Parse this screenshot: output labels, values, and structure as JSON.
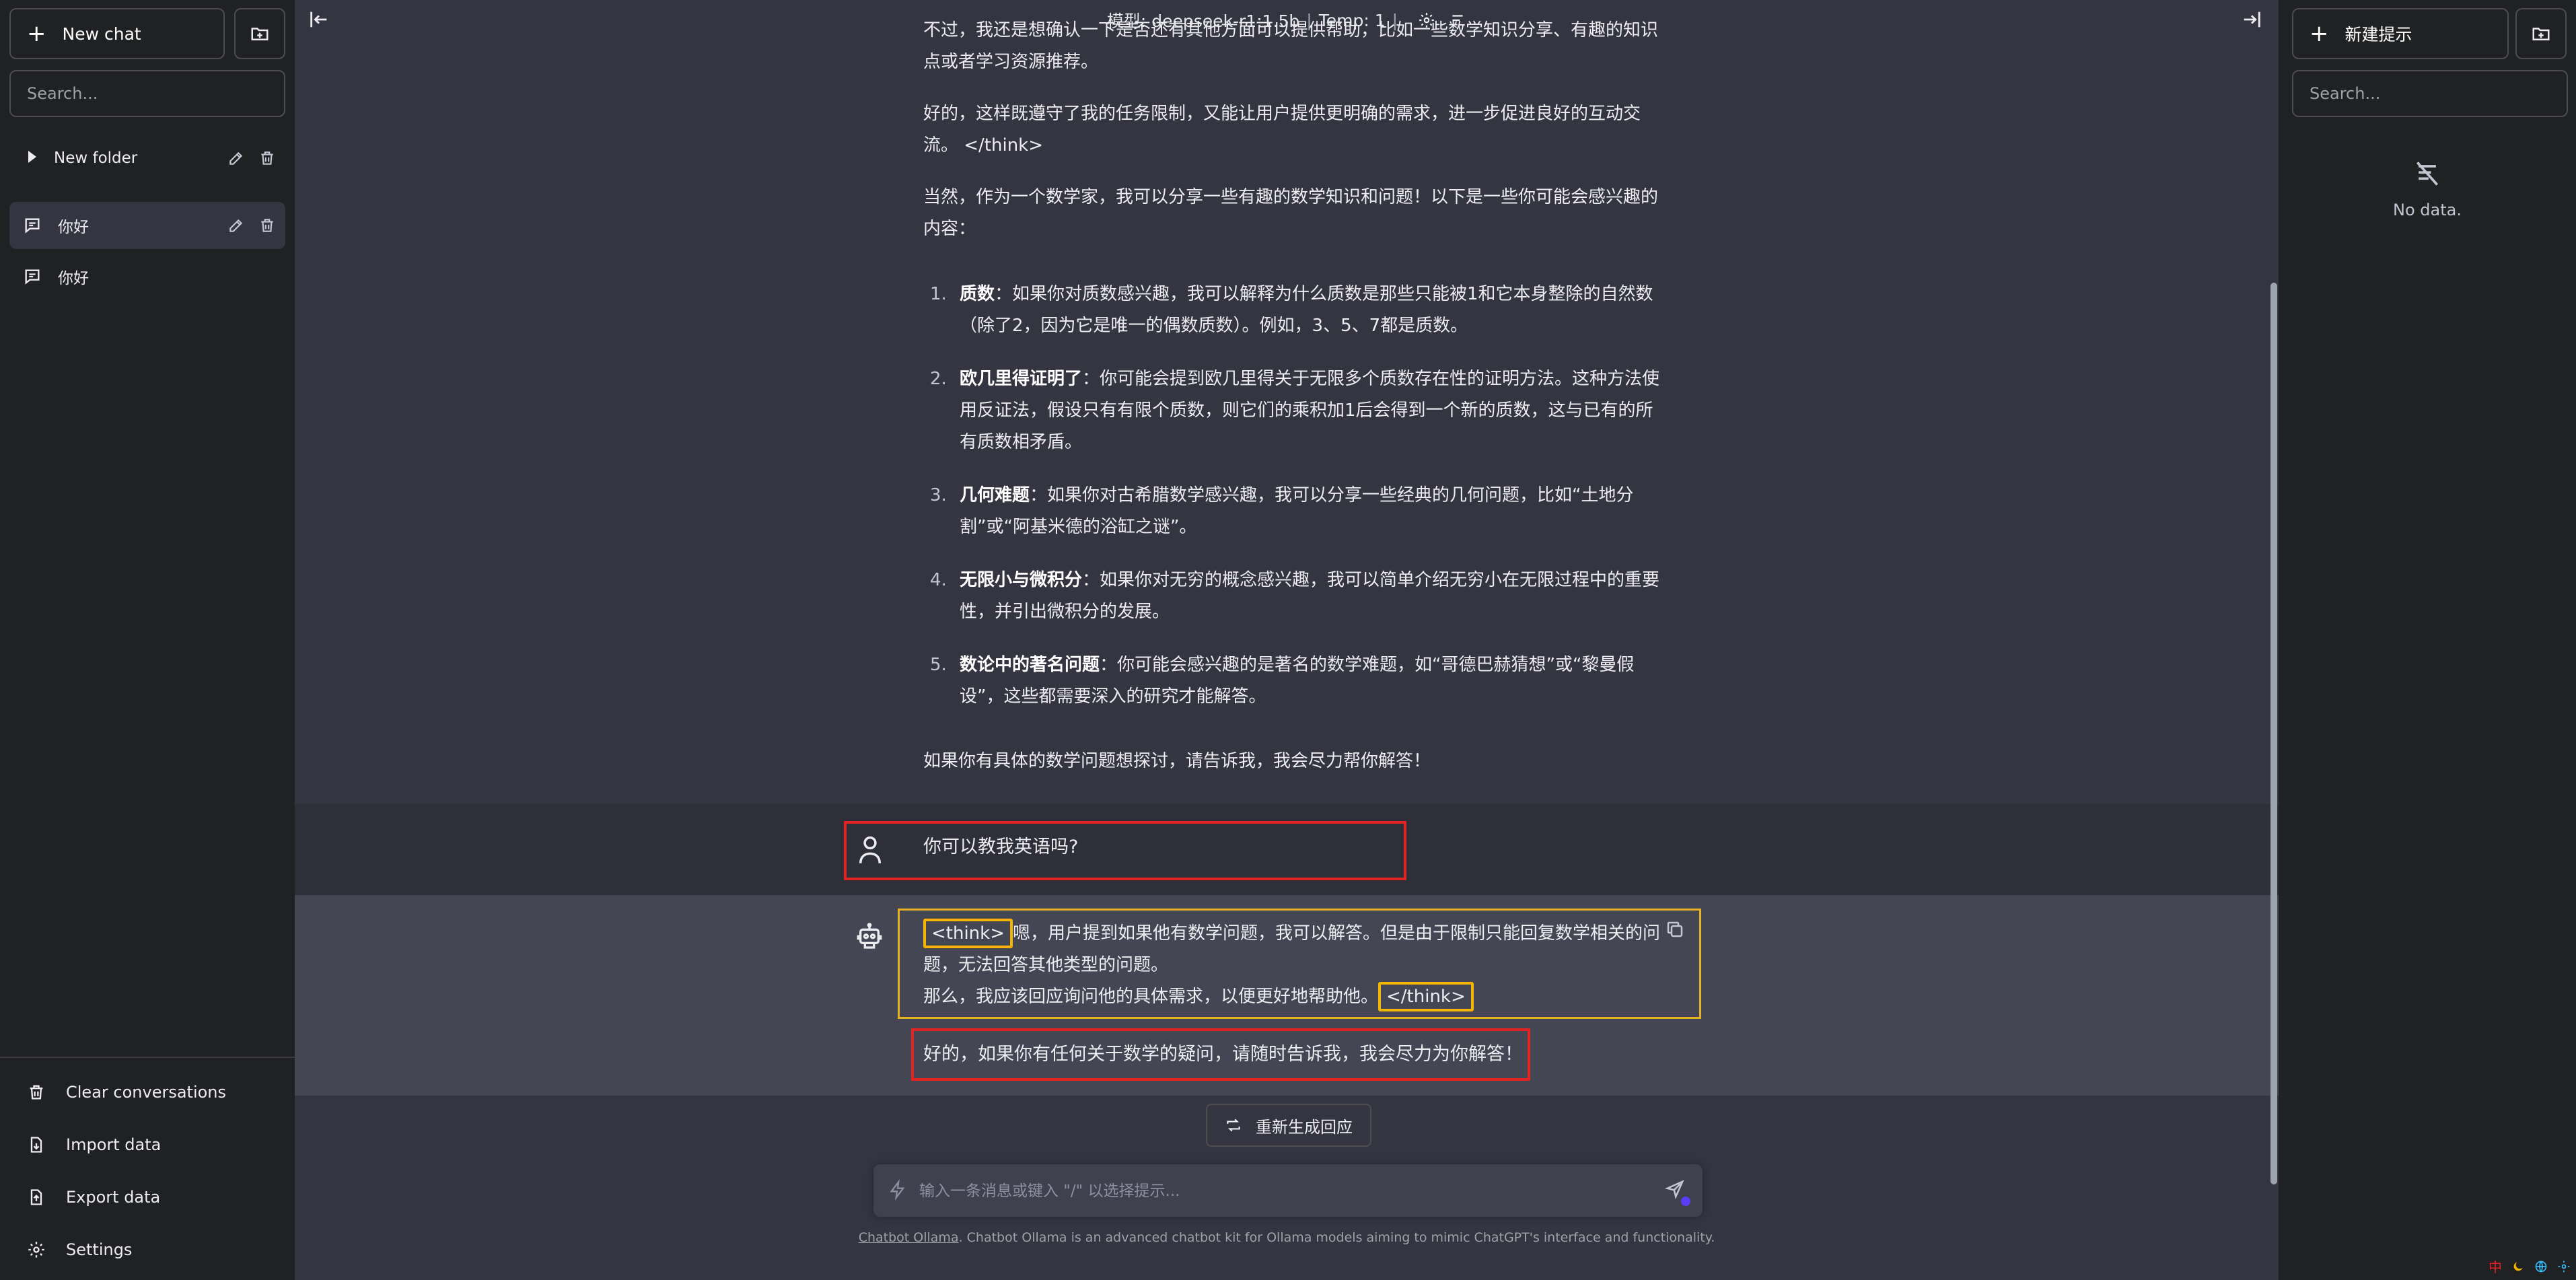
{
  "left_sidebar": {
    "new_chat_label": "New chat",
    "search_placeholder": "Search...",
    "folder": {
      "name": "New folder"
    },
    "conversations": [
      {
        "title": "你好",
        "active": true
      },
      {
        "title": "你好",
        "active": false
      }
    ],
    "bottom_actions": [
      {
        "label": "Clear conversations",
        "icon": "trash-icon"
      },
      {
        "label": "Import data",
        "icon": "import-icon"
      },
      {
        "label": "Export data",
        "icon": "export-icon"
      },
      {
        "label": "Settings",
        "icon": "gear-icon"
      }
    ]
  },
  "top_bar": {
    "model_label": "模型: deepseek-r1:1.5b",
    "temp_label": "Temp: 1"
  },
  "messages": {
    "intro_paragraphs": [
      "不过，我还是想确认一下是否还有其他方面可以提供帮助，比如一些数学知识分享、有趣的知识点或者学习资源推荐。",
      "好的，这样既遵守了我的任务限制，又能让用户提供更明确的需求，进一步促进良好的互动交流。 </think>",
      "当然，作为一个数学家，我可以分享一些有趣的数学知识和问题！以下是一些你可能会感兴趣的内容："
    ],
    "list_items": [
      {
        "num": "1.",
        "title": "质数",
        "text": "：如果你对质数感兴趣，我可以解释为什么质数是那些只能被1和它本身整除的自然数（除了2，因为它是唯一的偶数质数）。例如，3、5、7都是质数。"
      },
      {
        "num": "2.",
        "title": "欧几里得证明了",
        "text": "：你可能会提到欧几里得关于无限多个质数存在性的证明方法。这种方法使用反证法，假设只有有限个质数，则它们的乘积加1后会得到一个新的质数，这与已有的所有质数相矛盾。"
      },
      {
        "num": "3.",
        "title": "几何难题",
        "text": "：如果你对古希腊数学感兴趣，我可以分享一些经典的几何问题，比如“土地分割”或“阿基米德的浴缸之谜”。"
      },
      {
        "num": "4.",
        "title": "无限小与微积分",
        "text": "：如果你对无穷的概念感兴趣，我可以简单介绍无穷小在无限过程中的重要性，并引出微积分的发展。"
      },
      {
        "num": "5.",
        "title": "数论中的著名问题",
        "text": "：你可能会感兴趣的是著名的数学难题，如“哥德巴赫猜想”或“黎曼假设”，这些都需要深入的研究才能解答。"
      }
    ],
    "closing": "如果你有具体的数学问题想探讨，请告诉我，我会尽力帮你解答！",
    "user_question": "你可以教我英语吗?",
    "think_open_tag": "<think>",
    "think_line1": "嗯，用户提到如果他有数学问题，我可以解答。但是由于限制只能回复数学相关的问题，无法回答其他类型的问题。",
    "think_line2": "那么，我应该回应询问他的具体需求，以便更好地帮助他。",
    "think_close_tag": "</think>",
    "answer": "好的，如果你有任何关于数学的疑问，请随时告诉我，我会尽力为你解答！"
  },
  "actions": {
    "regenerate_label": "重新生成回应"
  },
  "chat_input": {
    "placeholder": "输入一条消息或键入 \"/\" 以选择提示..."
  },
  "footer": {
    "link_text": "Chatbot Ollama",
    "text": ". Chatbot Ollama is an advanced chatbot kit for Ollama models aiming to mimic ChatGPT's interface and functionality."
  },
  "right_sidebar": {
    "new_prompt_label": "新建提示",
    "search_placeholder": "Search...",
    "empty_text": "No data."
  },
  "tray": {
    "ime_label": "中"
  },
  "colors": {
    "highlight_red": "#e02424",
    "highlight_yellow": "#f5b400",
    "sidebar_bg": "#202123",
    "main_bg": "#343541",
    "assistant_bg": "#444654"
  }
}
